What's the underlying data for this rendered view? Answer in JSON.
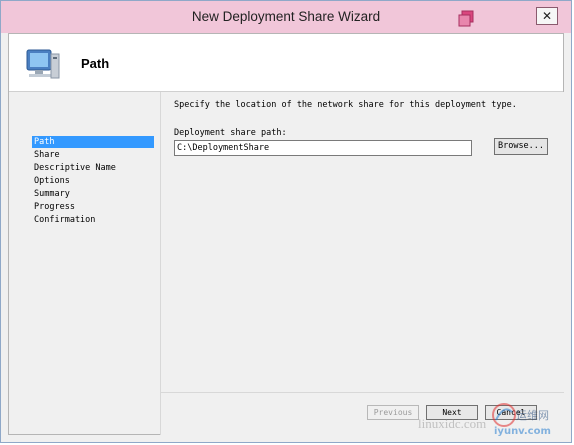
{
  "window": {
    "title": "New Deployment Share Wizard",
    "close_label": "✕"
  },
  "header": {
    "title": "Path"
  },
  "nav": {
    "items": [
      {
        "label": "Path",
        "active": true
      },
      {
        "label": "Share",
        "active": false
      },
      {
        "label": "Descriptive Name",
        "active": false
      },
      {
        "label": "Options",
        "active": false
      },
      {
        "label": "Summary",
        "active": false
      },
      {
        "label": "Progress",
        "active": false
      },
      {
        "label": "Confirmation",
        "active": false
      }
    ]
  },
  "content": {
    "description": "Specify the location of the network share for this deployment type.",
    "path_label": "Deployment share path:",
    "path_value": "C:\\DeploymentShare",
    "browse_label": "Browse..."
  },
  "footer": {
    "previous_label": "Previous",
    "next_label": "Next",
    "cancel_label": "Cancel"
  },
  "watermark": {
    "text": "linuxidc.com",
    "brand": "iyunv.com",
    "cn_text": "运维网"
  },
  "colors": {
    "titlebar": "#f1c6d9",
    "accent": "#3399ff"
  }
}
